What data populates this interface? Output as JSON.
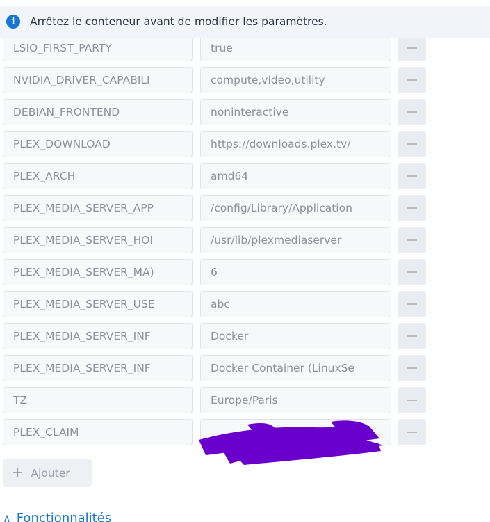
{
  "notice": {
    "icon": "info-icon",
    "text": "Arrêtez le conteneur avant de modifier les paramètres."
  },
  "env_rows": [
    {
      "name": "LSIO_FIRST_PARTY",
      "value": "true"
    },
    {
      "name": "NVIDIA_DRIVER_CAPABILI",
      "value": "compute,video,utility"
    },
    {
      "name": "DEBIAN_FRONTEND",
      "value": "noninteractive"
    },
    {
      "name": "PLEX_DOWNLOAD",
      "value": "https://downloads.plex.tv/"
    },
    {
      "name": "PLEX_ARCH",
      "value": "amd64"
    },
    {
      "name": "PLEX_MEDIA_SERVER_APP",
      "value": "/config/Library/Application"
    },
    {
      "name": "PLEX_MEDIA_SERVER_HOI",
      "value": "/usr/lib/plexmediaserver"
    },
    {
      "name": "PLEX_MEDIA_SERVER_MA)",
      "value": "6"
    },
    {
      "name": "PLEX_MEDIA_SERVER_USE",
      "value": "abc"
    },
    {
      "name": "PLEX_MEDIA_SERVER_INF",
      "value": "Docker"
    },
    {
      "name": "PLEX_MEDIA_SERVER_INF",
      "value": "Docker Container (LinuxSe"
    },
    {
      "name": "TZ",
      "value": "Europe/Paris"
    },
    {
      "name": "PLEX_CLAIM",
      "value": ""
    }
  ],
  "add_button": {
    "label": "Ajouter",
    "icon": "plus-icon"
  },
  "section": {
    "label": "Fonctionnalités",
    "icon": "chevron-up-icon"
  },
  "colors": {
    "accent": "#1477d4",
    "redaction": "#6a00cc"
  }
}
